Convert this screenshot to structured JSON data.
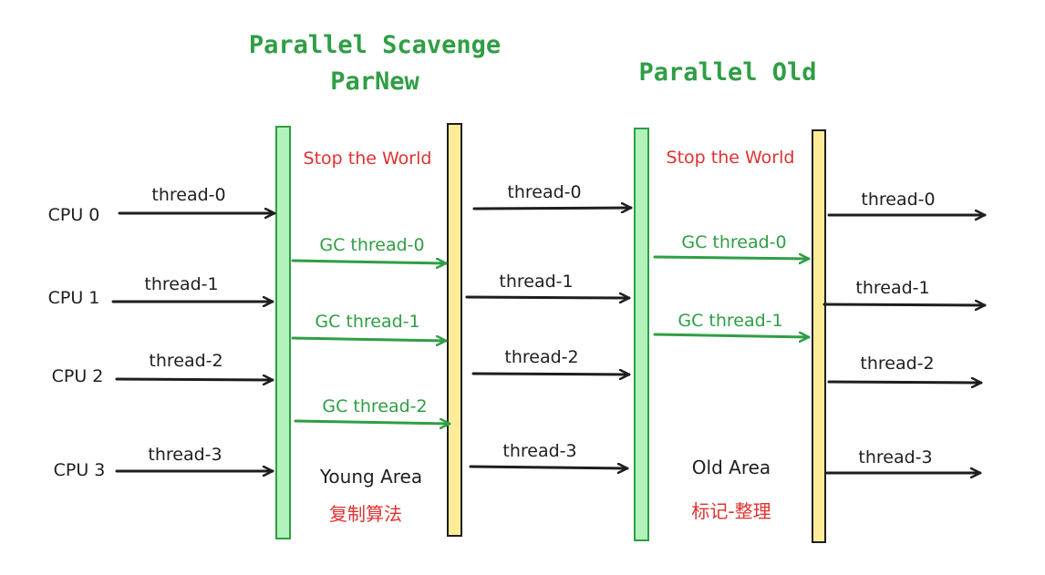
{
  "titles": {
    "young_line1": "Parallel Scavenge",
    "young_line2": "ParNew",
    "old": "Parallel Old"
  },
  "stop_the_world": [
    "Stop the World",
    "Stop the World"
  ],
  "cpus": [
    "CPU 0",
    "CPU 1",
    "CPU 2",
    "CPU 3"
  ],
  "threads": [
    "thread-0",
    "thread-1",
    "thread-2",
    "thread-3"
  ],
  "gc_young": [
    "GC thread-0",
    "GC thread-1",
    "GC thread-2"
  ],
  "gc_old": [
    "GC thread-0",
    "GC thread-1"
  ],
  "young_area": {
    "name": "Young Area",
    "algorithm": "复制算法"
  },
  "old_area": {
    "name": "Old Area",
    "algorithm": "标记-整理"
  },
  "colors": {
    "green_bar_fill": "#b2f2bb",
    "green_bar_stroke": "#2f9e44",
    "yellow_bar_fill": "#ffec99",
    "yellow_bar_stroke": "#1e1e1e",
    "arrow_black": "#1e1e1e",
    "arrow_green": "#2f9e44",
    "title_green": "#2f9e44",
    "stw_red": "#e03131"
  }
}
